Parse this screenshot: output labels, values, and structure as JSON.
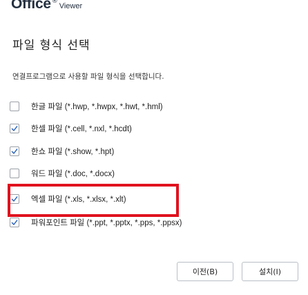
{
  "header": {
    "brand_title": "Office",
    "brand_reg": "®",
    "brand_sub": "Viewer"
  },
  "dialog": {
    "heading": "파일 형식 선택",
    "description": "연결프로그램으로 사용할 파일 형식을 선택합니다."
  },
  "options": [
    {
      "label": "한글 파일 (*.hwp, *.hwpx, *.hwt, *.hml)",
      "checked": false
    },
    {
      "label": "한셀 파일 (*.cell, *.nxl, *.hcdt)",
      "checked": true
    },
    {
      "label": "한쇼 파일 (*.show, *.hpt)",
      "checked": true
    },
    {
      "label": "워드 파일 (*.doc, *.docx)",
      "checked": false
    },
    {
      "label": "엑셀 파일 (*.xls, *.xlsx, *.xlt)",
      "checked": true
    },
    {
      "label": "파워포인트 파일 (*.ppt, *.pptx, *.pps, *.ppsx)",
      "checked": true
    }
  ],
  "buttons": {
    "back": "이전(B)",
    "install": "설치(I)"
  },
  "colors": {
    "highlight": "#e0121e",
    "check": "#1f5bb6"
  }
}
